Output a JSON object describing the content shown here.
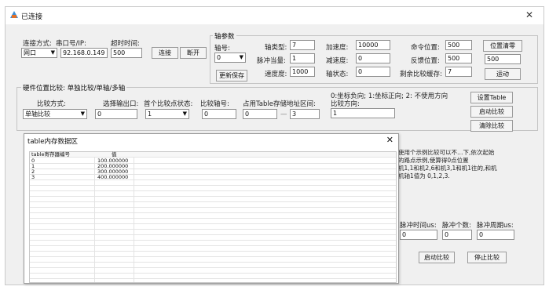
{
  "window": {
    "title": "已连接"
  },
  "conn": {
    "mode_label": "连接方式:",
    "mode_value": "网口",
    "ip_label": "串口号/IP:",
    "ip_value": "92.168.0.149",
    "timeout_label": "超时时间:",
    "timeout_value": "500",
    "connect": "连接",
    "disconnect": "断开"
  },
  "axis": {
    "group": "轴参数",
    "axis_label": "轴号:",
    "axis_value": "0",
    "update": "更新保存",
    "type_label": "轴类型:",
    "type_value": "7",
    "accel_label": "加速度:",
    "accel_value": "10000",
    "cmdpos_label": "命令位置:",
    "cmdpos_value": "500",
    "units_label": "脉冲当量:",
    "units_value": "1",
    "decel_label": "减速度:",
    "decel_value": "0",
    "feedback_label": "反馈位置:",
    "feedback_value": "500",
    "speed_label": "速度度:",
    "speed_value": "1000",
    "status_label": "轴状态:",
    "status_value": "0",
    "remain_label": "剩余比较缓存:",
    "remain_value": "7",
    "setzero": "位置清零",
    "move_value": "500",
    "move_btn": "运动"
  },
  "cmp": {
    "group": "硬件位置比较: 单独比较/单轴/多轴",
    "mode_label": "比较方式:",
    "mode_value": "单轴比较",
    "out_label": "选择输出口:",
    "out_value": "0",
    "first_label": "首个比较点状态:",
    "first_value": "1",
    "axis_label": "比较轴号:",
    "axis_value": "0",
    "table_label": "占用Table存储地址区间:",
    "table_from": "0",
    "table_to": "3",
    "dir_hint": "0:坐标负向; 1:坐标正向; 2: 不使用方向",
    "dir_label": "比较方向:",
    "dir_value": "1",
    "set_table": "设置Table",
    "start": "启动比较",
    "clear": "清除比较"
  },
  "right_note": {
    "line1": "使用个示例比较可以不…下,依次起始",
    "line2": "的路点示例,使算得0点位置",
    "line3": "机1,1和机2,6和机3,1和机1往的,和机",
    "line4": "机轴1值为 0,1,2,3."
  },
  "pulse": {
    "label1": "脉冲时间us:",
    "label2": "脉冲个数:",
    "label3": "脉冲周期us:",
    "v1": "0",
    "v2": "0",
    "v3": "0",
    "start": "启动比较",
    "stop": "停止比较"
  },
  "dialog": {
    "title": "table内存数据区",
    "col1": "table寄存器编号",
    "col2": "值",
    "rows": [
      {
        "idx": "0",
        "val": "100.000000"
      },
      {
        "idx": "1",
        "val": "200.000000"
      },
      {
        "idx": "2",
        "val": "300.000000"
      },
      {
        "idx": "3",
        "val": "400.000000"
      }
    ]
  }
}
